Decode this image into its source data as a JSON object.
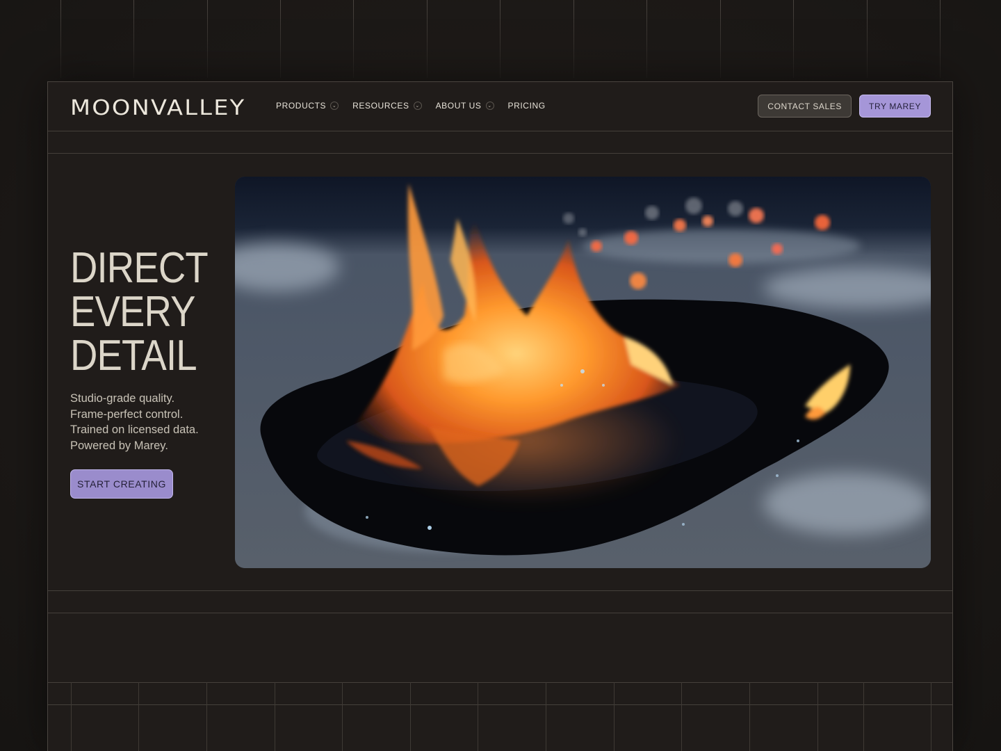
{
  "brand": {
    "logo_text": "MOONVALLEY"
  },
  "nav": {
    "items": [
      {
        "label": "PRODUCTS",
        "has_dropdown": true
      },
      {
        "label": "RESOURCES",
        "has_dropdown": true
      },
      {
        "label": "ABOUT US",
        "has_dropdown": true
      },
      {
        "label": "PRICING",
        "has_dropdown": false
      }
    ],
    "contact_label": "CONTACT SALES",
    "try_label": "TRY MAREY"
  },
  "hero": {
    "title_lines": [
      "DIRECT",
      "EVERY",
      "DETAIL"
    ],
    "subtitle_lines": [
      "Studio-grade quality.",
      "Frame-perfect control.",
      "Trained on licensed data.",
      "Powered by Marey."
    ],
    "cta_label": "START CREATING",
    "media_icon": "fire-on-ice-video"
  },
  "colors": {
    "background": "#1c1917",
    "accent_purple": "#a596d8",
    "text": "#dcd6c9",
    "grid_line": "#45403b"
  }
}
